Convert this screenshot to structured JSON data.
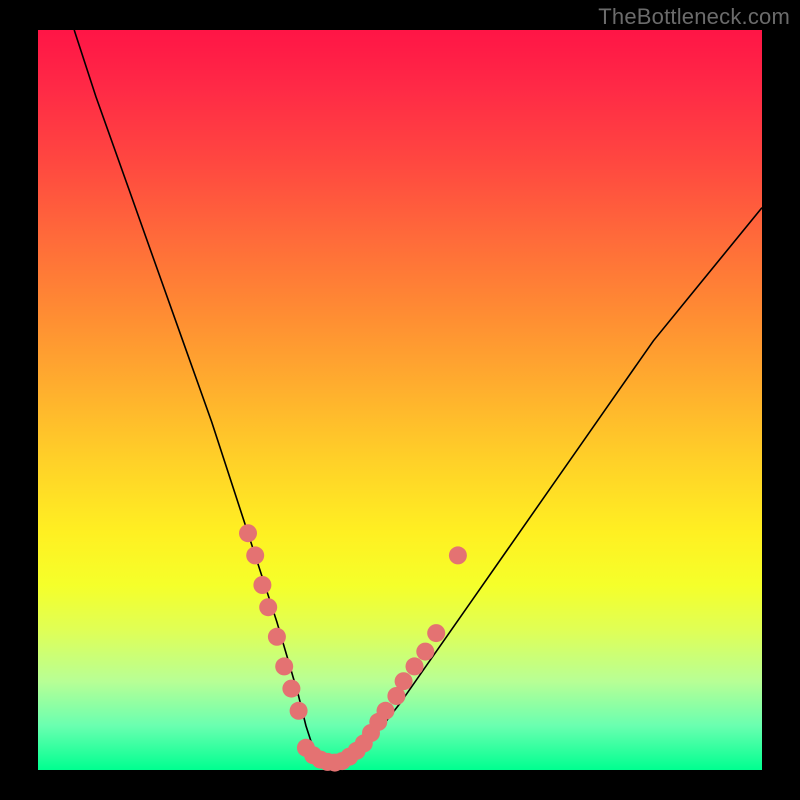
{
  "watermark": "TheBottleneck.com",
  "colors": {
    "dot": "#e47272",
    "curve": "#000000",
    "frame": "#000000"
  },
  "chart_data": {
    "type": "line",
    "title": "",
    "xlabel": "",
    "ylabel": "",
    "xlim": [
      0,
      100
    ],
    "ylim": [
      0,
      100
    ],
    "grid": false,
    "legend": false,
    "note": "No axis tick labels are rendered; x maps left→right across the plot, y maps bottom(0)→top(100). Values are visual estimates.",
    "series": [
      {
        "name": "curve",
        "x": [
          5,
          8,
          12,
          16,
          20,
          24,
          27,
          29,
          31,
          33,
          34.5,
          36,
          37,
          38,
          40,
          42,
          44,
          46,
          50,
          55,
          60,
          65,
          70,
          75,
          80,
          85,
          90,
          95,
          100
        ],
        "y": [
          100,
          91,
          80,
          69,
          58,
          47,
          38,
          32,
          26,
          20,
          15,
          10,
          6,
          3,
          1,
          1,
          2,
          4,
          9,
          16,
          23,
          30,
          37,
          44,
          51,
          58,
          64,
          70,
          76
        ]
      }
    ],
    "points_left": [
      {
        "x": 29.0,
        "y": 32
      },
      {
        "x": 30.0,
        "y": 29
      },
      {
        "x": 31.0,
        "y": 25
      },
      {
        "x": 31.8,
        "y": 22
      },
      {
        "x": 33.0,
        "y": 18
      },
      {
        "x": 34.0,
        "y": 14
      },
      {
        "x": 35.0,
        "y": 11
      },
      {
        "x": 36.0,
        "y": 8
      }
    ],
    "points_bottom": [
      {
        "x": 37.0,
        "y": 3.0
      },
      {
        "x": 38.0,
        "y": 2.0
      },
      {
        "x": 39.0,
        "y": 1.4
      },
      {
        "x": 40.0,
        "y": 1.1
      },
      {
        "x": 41.0,
        "y": 1.0
      },
      {
        "x": 42.0,
        "y": 1.2
      },
      {
        "x": 43.0,
        "y": 1.8
      },
      {
        "x": 44.0,
        "y": 2.6
      },
      {
        "x": 45.0,
        "y": 3.6
      }
    ],
    "points_right": [
      {
        "x": 46.0,
        "y": 5.0
      },
      {
        "x": 47.0,
        "y": 6.5
      },
      {
        "x": 48.0,
        "y": 8.0
      },
      {
        "x": 49.5,
        "y": 10.0
      },
      {
        "x": 50.5,
        "y": 12.0
      },
      {
        "x": 52.0,
        "y": 14.0
      },
      {
        "x": 53.5,
        "y": 16.0
      },
      {
        "x": 55.0,
        "y": 18.5
      },
      {
        "x": 58.0,
        "y": 29.0
      }
    ]
  }
}
